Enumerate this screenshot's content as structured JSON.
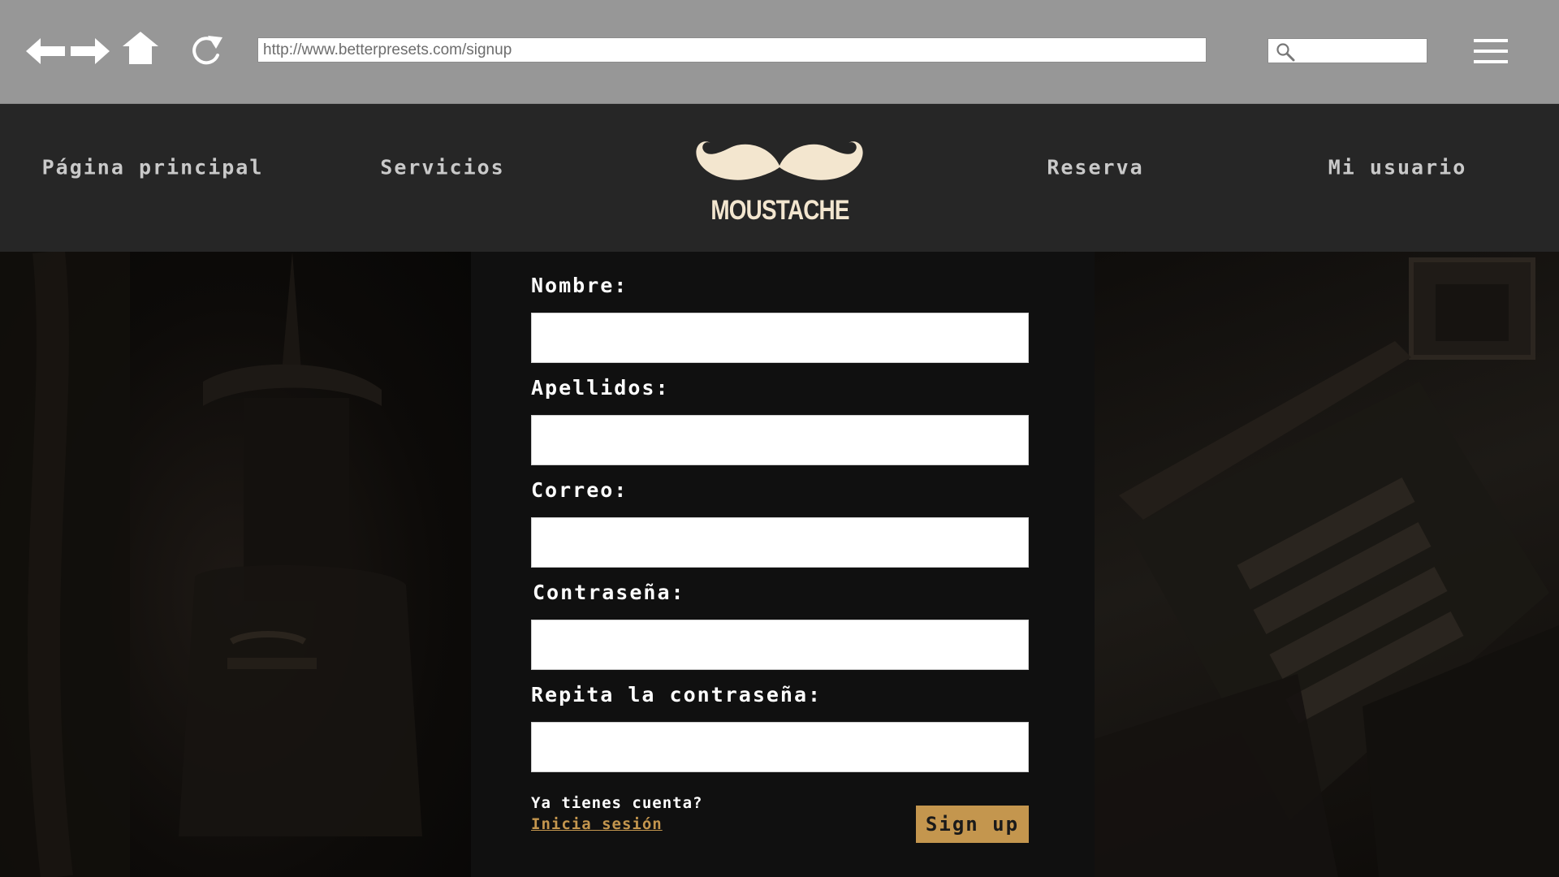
{
  "browser": {
    "url": "http://www.betterpresets.com/signup",
    "search_placeholder": ""
  },
  "nav": {
    "items": [
      {
        "label": "Página principal"
      },
      {
        "label": "Servicios"
      },
      {
        "label": "Reserva"
      },
      {
        "label": "Mi usuario"
      }
    ],
    "logo_text": "MOUSTACHE"
  },
  "form": {
    "fields": [
      {
        "label": "Nombre:",
        "value": ""
      },
      {
        "label": "Apellidos:",
        "value": ""
      },
      {
        "label": "Correo:",
        "value": ""
      },
      {
        "label": "Contraseña:",
        "value": ""
      },
      {
        "label": "Repita la contraseña:",
        "value": ""
      }
    ],
    "login_question": "Ya tienes cuenta?",
    "login_link": "Inicia sesión",
    "submit_label": "Sign up"
  },
  "colors": {
    "chrome": "#979797",
    "nav_background": "#262626",
    "form_background": "#101010",
    "accent": "#c4964e",
    "logo": "#f3e6cf"
  },
  "icons": {
    "back": "arrow-left-icon",
    "forward": "arrow-right-icon",
    "home": "home-icon",
    "reload": "reload-icon",
    "search": "search-icon",
    "menu": "hamburger-menu-icon"
  }
}
